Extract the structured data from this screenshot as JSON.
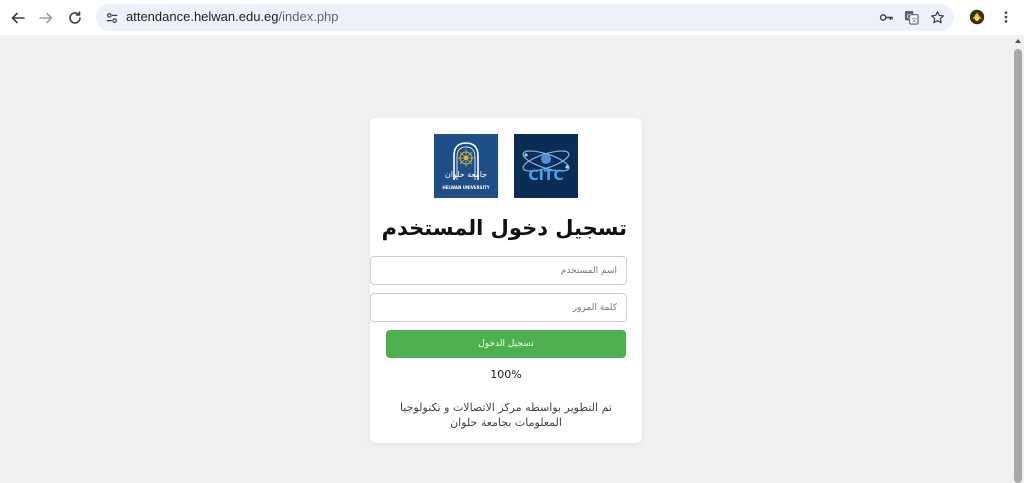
{
  "browser": {
    "url_domain": "attendance.helwan.edu.eg",
    "url_path": "/index.php",
    "back_icon": "arrow-left",
    "forward_icon": "arrow-right",
    "reload_icon": "reload",
    "omnibox_icons": [
      "key-icon",
      "translate-icon",
      "star-icon"
    ],
    "menu_icon": "vertical-dots"
  },
  "login": {
    "title": "تسجيل دخول المستخدم",
    "username_placeholder": "اسم المستخدم",
    "password_placeholder": "كلمة المرور",
    "submit_label": "تسجيل الدخول",
    "progress_text": "100%",
    "footer": "تم التطوير بواسطه مركز الاتصالات و تكنولوجيا المعلومات بجامعة حلوان"
  },
  "logos": {
    "university_arabic": "جامعة حلوان",
    "university_english": "HELWAN UNIVERSITY",
    "citc_text": "CITC"
  },
  "colors": {
    "page_background": "#f1f1f1",
    "button_green": "#4caf50",
    "omnibox_bg": "#edf2fa"
  }
}
